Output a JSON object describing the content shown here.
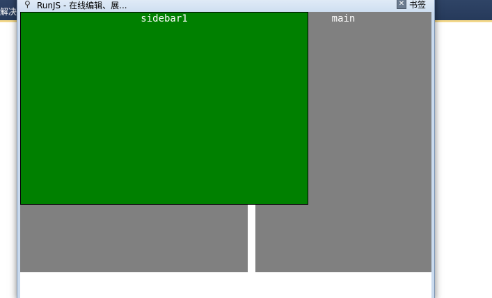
{
  "background": {
    "left_text": "解决",
    "strip_color": "#2c4164",
    "accent_color": "#f3d88b"
  },
  "window": {
    "title": "RunJS - 在线编辑、展...",
    "app_icon": "runjs-logo-icon",
    "bookmark_label": "书签",
    "bookmark_icon": "bookmark-icon"
  },
  "content": {
    "sidebar1": {
      "label": "sidebar1",
      "color": "#008000"
    },
    "sidebar2": {
      "label": "",
      "color": "#808080"
    },
    "main": {
      "label": "main",
      "color": "#808080"
    }
  }
}
